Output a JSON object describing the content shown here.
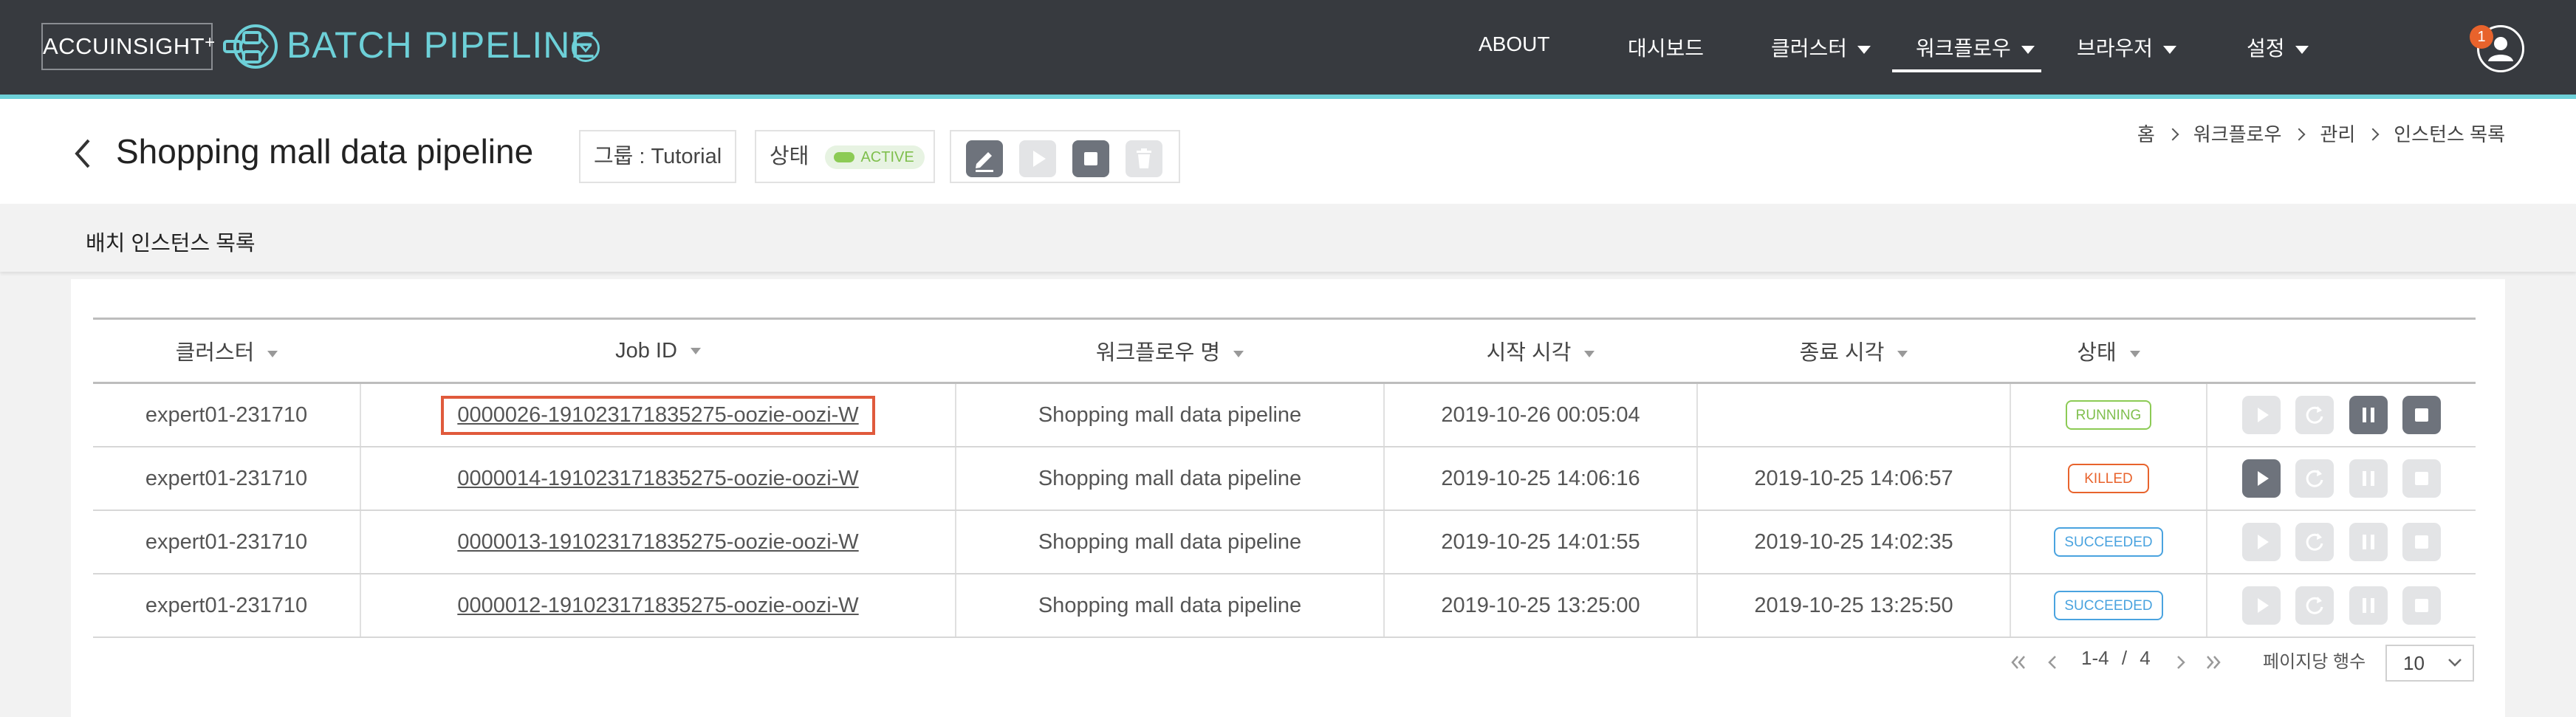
{
  "brand": {
    "name": "ACCUINSIGHT",
    "sup": "+",
    "product": "BATCH PIPELINE"
  },
  "nav": {
    "about": "ABOUT",
    "dashboard": "대시보드",
    "cluster": "클러스터",
    "workflow": "워크플로우",
    "browser": "브라우저",
    "settings": "설정",
    "active": "워크플로우",
    "notification_count": "1"
  },
  "header": {
    "title": "Shopping mall data pipeline",
    "group_label": "그룹 : Tutorial",
    "state_label": "상태",
    "state_value": "ACTIVE",
    "breadcrumb": [
      "홈",
      "워크플로우",
      "관리",
      "인스턴스 목록"
    ]
  },
  "section": {
    "title": "배치 인스턴스 목록"
  },
  "table": {
    "columns": [
      "클러스터",
      "Job ID",
      "워크플로우 명",
      "시작 시각",
      "종료 시각",
      "상태",
      ""
    ],
    "rows": [
      {
        "cluster": "expert01-231710",
        "job_id": "0000026-191023171835275-oozie-oozi-W",
        "workflow": "Shopping mall data pipeline",
        "start": "2019-10-26 00:05:04",
        "end": "",
        "status": "RUNNING"
      },
      {
        "cluster": "expert01-231710",
        "job_id": "0000014-191023171835275-oozie-oozi-W",
        "workflow": "Shopping mall data pipeline",
        "start": "2019-10-25 14:06:16",
        "end": "2019-10-25 14:06:57",
        "status": "KILLED"
      },
      {
        "cluster": "expert01-231710",
        "job_id": "0000013-191023171835275-oozie-oozi-W",
        "workflow": "Shopping mall data pipeline",
        "start": "2019-10-25 14:01:55",
        "end": "2019-10-25 14:02:35",
        "status": "SUCCEEDED"
      },
      {
        "cluster": "expert01-231710",
        "job_id": "0000012-191023171835275-oozie-oozi-W",
        "workflow": "Shopping mall data pipeline",
        "start": "2019-10-25 13:25:00",
        "end": "2019-10-25 13:25:50",
        "status": "SUCCEEDED"
      }
    ]
  },
  "pagination": {
    "range": "1-4",
    "divider": "/",
    "total": "4",
    "per_page_label": "페이지당 행수",
    "per_page_value": "10"
  },
  "colors": {
    "topbar": "#373a3f",
    "accent": "#6dd0d8",
    "running": "#7fbf4d",
    "killed": "#e8632c",
    "succeeded": "#4aa3df",
    "highlight": "#e05a3c",
    "button_dark": "#6e737c",
    "button_light": "#e3e4e6"
  },
  "icons": [
    "pipeline-logo-icon",
    "dropdown-caret-icon",
    "user-icon",
    "back-arrow-icon",
    "edit-icon",
    "play-icon",
    "stop-icon",
    "trash-icon",
    "refresh-icon",
    "pause-icon",
    "sort-icon",
    "first-page-icon",
    "prev-page-icon",
    "next-page-icon",
    "last-page-icon",
    "chevron-down-icon"
  ]
}
